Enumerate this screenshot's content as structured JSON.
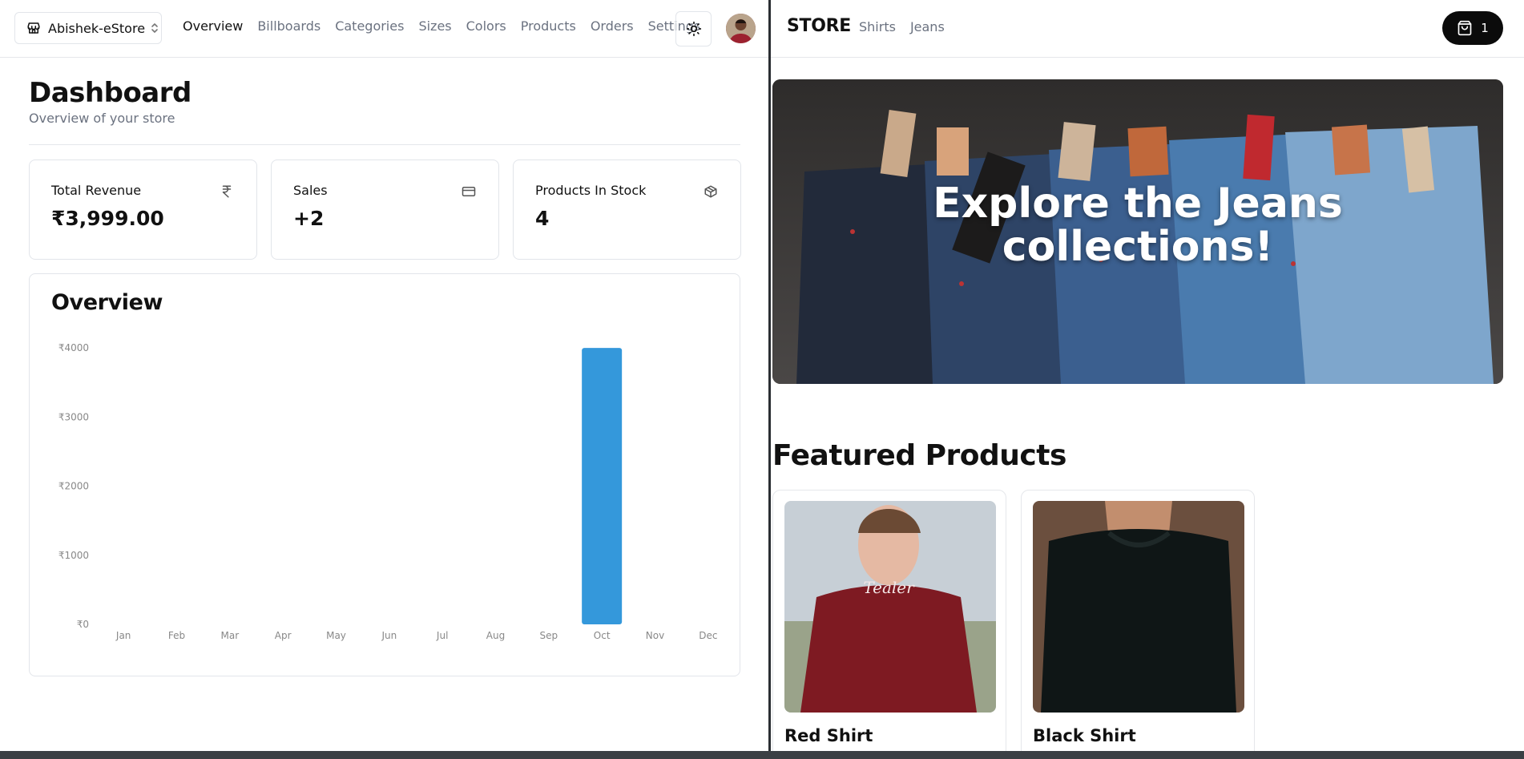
{
  "admin": {
    "store_switcher": {
      "label": "Abishek-eStore"
    },
    "nav": [
      "Overview",
      "Billboards",
      "Categories",
      "Sizes",
      "Colors",
      "Products",
      "Orders",
      "Settings"
    ],
    "active_nav": "Overview",
    "heading": {
      "title": "Dashboard",
      "subtitle": "Overview of your store"
    },
    "cards": [
      {
        "label": "Total Revenue",
        "value": "₹3,999.00",
        "icon": "rupee-icon"
      },
      {
        "label": "Sales",
        "value": "+2",
        "icon": "credit-card-icon"
      },
      {
        "label": "Products In Stock",
        "value": "4",
        "icon": "package-icon"
      }
    ],
    "overview_title": "Overview"
  },
  "chart_data": {
    "type": "bar",
    "categories": [
      "Jan",
      "Feb",
      "Mar",
      "Apr",
      "May",
      "Jun",
      "Jul",
      "Aug",
      "Sep",
      "Oct",
      "Nov",
      "Dec"
    ],
    "values": [
      0,
      0,
      0,
      0,
      0,
      0,
      0,
      0,
      0,
      3999,
      0,
      0
    ],
    "ylim": [
      0,
      4000
    ],
    "yticks": [
      0,
      1000,
      2000,
      3000,
      4000
    ],
    "ytick_labels": [
      "₹0",
      "₹1000",
      "₹2000",
      "₹3000",
      "₹4000"
    ],
    "bar_color": "#3498db",
    "grid": false
  },
  "store": {
    "logo": "STORE",
    "links": [
      "Shirts",
      "Jeans"
    ],
    "cart_count": "1",
    "hero_text_line1": "Explore the Jeans",
    "hero_text_line2": "collections!",
    "featured_title": "Featured Products",
    "products": [
      {
        "name": "Red Shirt"
      },
      {
        "name": "Black Shirt"
      }
    ]
  },
  "colors": {
    "accent_bar": "#3498db",
    "cart_bg": "#0b0b0b",
    "muted_text": "#6b7280"
  }
}
